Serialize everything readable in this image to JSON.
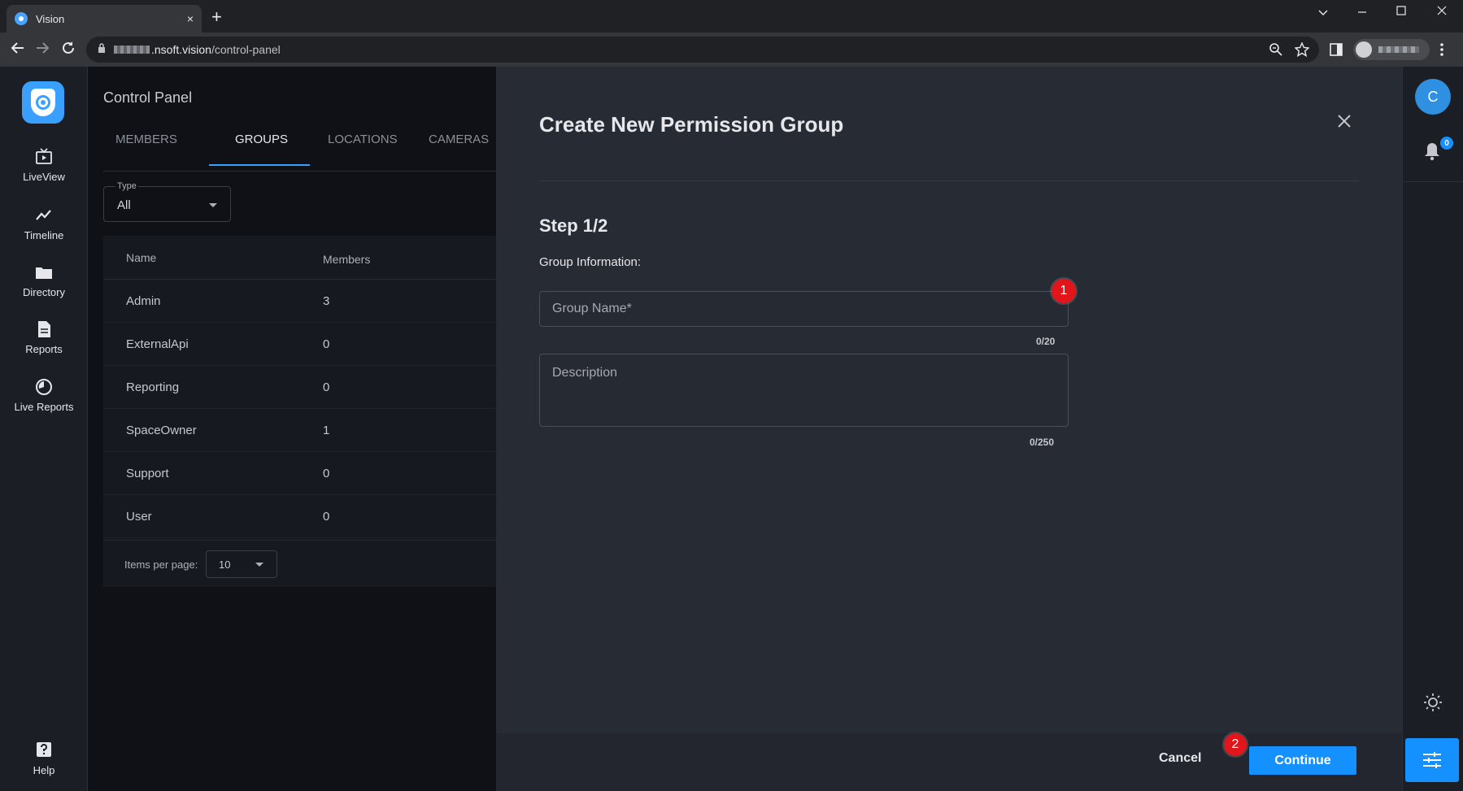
{
  "browser": {
    "tab_title": "Vision",
    "tab_close": "×",
    "new_tab": "+",
    "url_prefix": ".nsoft.vision",
    "url_path": "/control-panel"
  },
  "nav": {
    "items": [
      {
        "label": "LiveView",
        "icon": "tv-play-icon"
      },
      {
        "label": "Timeline",
        "icon": "trend-line-icon"
      },
      {
        "label": "Directory",
        "icon": "folder-icon"
      },
      {
        "label": "Reports",
        "icon": "document-icon"
      },
      {
        "label": "Live Reports",
        "icon": "dial-icon"
      }
    ],
    "help": "Help"
  },
  "page": {
    "title": "Control Panel",
    "tabs": [
      "MEMBERS",
      "GROUPS",
      "LOCATIONS",
      "CAMERAS"
    ],
    "active_tab": "GROUPS",
    "type_filter_label": "Type",
    "type_filter_value": "All",
    "table": {
      "headers": [
        "Name",
        "Members"
      ],
      "rows": [
        {
          "name": "Admin",
          "members": "3"
        },
        {
          "name": "ExternalApi",
          "members": "0"
        },
        {
          "name": "Reporting",
          "members": "0"
        },
        {
          "name": "SpaceOwner",
          "members": "1"
        },
        {
          "name": "Support",
          "members": "0"
        },
        {
          "name": "User",
          "members": "0"
        }
      ]
    },
    "items_per_page_label": "Items per page:",
    "items_per_page_value": "10"
  },
  "dialog": {
    "title": "Create New Permission Group",
    "step": "Step 1/2",
    "section_label": "Group Information:",
    "group_name_placeholder": "Group Name*",
    "group_name_counter": "0/20",
    "description_placeholder": "Description",
    "description_counter": "0/250",
    "badge_1": "1",
    "badge_2": "2",
    "cancel_label": "Cancel",
    "continue_label": "Continue"
  },
  "rail": {
    "avatar_letter": "C",
    "notification_count": "0"
  },
  "colors": {
    "accent": "#1591ff",
    "badge_red": "#e2151b",
    "dialog_bg": "#272b34"
  }
}
